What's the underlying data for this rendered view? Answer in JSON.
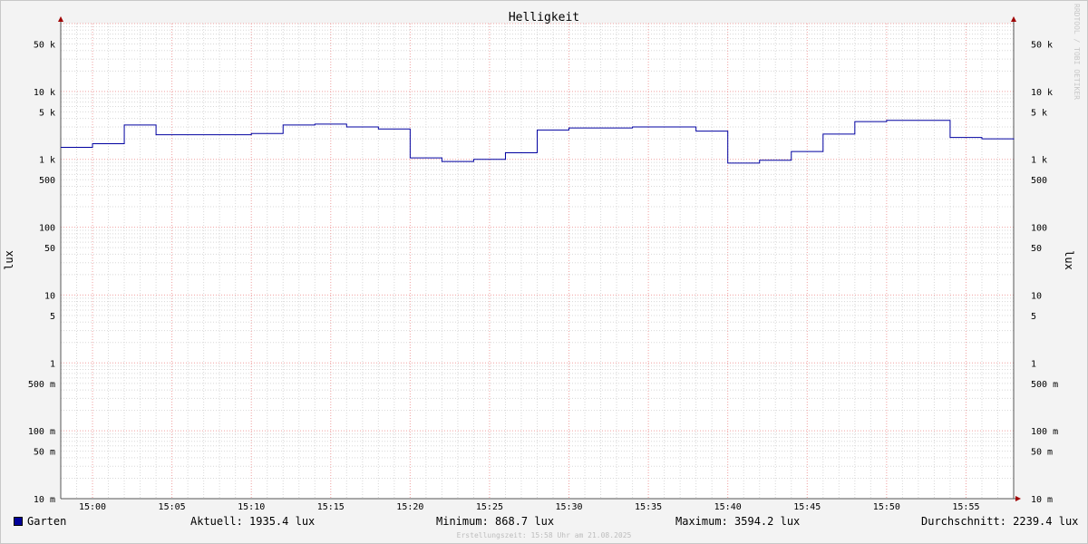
{
  "chart_data": {
    "type": "line",
    "title": "Helligkeit",
    "ylabel": "lux",
    "y_scale": "log",
    "ylim": [
      0.01,
      100000
    ],
    "xlim": [
      "14:58",
      "15:58"
    ],
    "grid": true,
    "line_style": "step",
    "y_ticks": [
      {
        "value": 50000,
        "label": "50 k"
      },
      {
        "value": 10000,
        "label": "10 k"
      },
      {
        "value": 5000,
        "label": "5 k"
      },
      {
        "value": 1000,
        "label": "1 k"
      },
      {
        "value": 500,
        "label": "500"
      },
      {
        "value": 100,
        "label": "100"
      },
      {
        "value": 50,
        "label": "50"
      },
      {
        "value": 10,
        "label": "10"
      },
      {
        "value": 5,
        "label": "5"
      },
      {
        "value": 1,
        "label": "1"
      },
      {
        "value": 0.5,
        "label": "500 m"
      },
      {
        "value": 0.1,
        "label": "100 m"
      },
      {
        "value": 0.05,
        "label": "50 m"
      },
      {
        "value": 0.01,
        "label": "10 m"
      }
    ],
    "x_ticks": [
      "15:00",
      "15:05",
      "15:10",
      "15:15",
      "15:20",
      "15:25",
      "15:30",
      "15:35",
      "15:40",
      "15:45",
      "15:50",
      "15:55"
    ],
    "series": [
      {
        "name": "Garten",
        "color": "#0000a0",
        "x": [
          "14:58",
          "15:00",
          "15:02",
          "15:04",
          "15:10",
          "15:12",
          "15:14",
          "15:16",
          "15:18",
          "15:20",
          "15:22",
          "15:24",
          "15:26",
          "15:28",
          "15:30",
          "15:34",
          "15:38",
          "15:40",
          "15:42",
          "15:44",
          "15:46",
          "15:48",
          "15:50",
          "15:54",
          "15:56",
          "15:58"
        ],
        "values": [
          1500,
          1700,
          3200,
          2300,
          2400,
          3200,
          3300,
          3000,
          2800,
          1050,
          930,
          1000,
          1250,
          2700,
          2900,
          3000,
          2600,
          880,
          970,
          1300,
          2350,
          3600,
          3750,
          2100,
          2000,
          1950
        ]
      }
    ]
  },
  "legend": {
    "series_name": "Garten",
    "series_color": "#000099",
    "current": "Aktuell: 1935.4 lux",
    "minimum": "Minimum: 868.7 lux",
    "maximum": "Maximum: 3594.2 lux",
    "average": "Durchschnitt: 2239.4 lux"
  },
  "footer": "Erstellungszeit: 15:58 Uhr am 21.08.2025",
  "watermark": "RRDTOOL / TOBI OETIKER"
}
